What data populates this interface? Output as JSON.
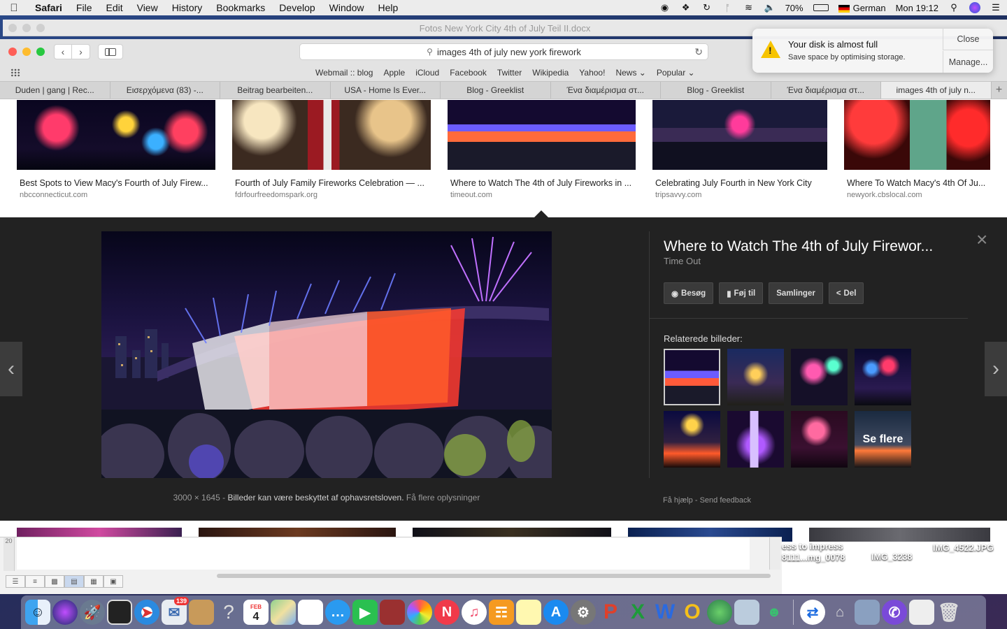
{
  "menubar": {
    "app": "Safari",
    "items": [
      "File",
      "Edit",
      "View",
      "History",
      "Bookmarks",
      "Develop",
      "Window",
      "Help"
    ],
    "battery": "70%",
    "input_source": "German",
    "clock": "Mon 19:12"
  },
  "doc_window": {
    "title": "Fotos New York City 4th of July Teil II.docx"
  },
  "toolbar": {
    "url": "images 4th of july new york firework",
    "favorites": [
      "Webmail :: blog",
      "Apple",
      "iCloud",
      "Facebook",
      "Twitter",
      "Wikipedia",
      "Yahoo!",
      "News ⌄",
      "Popular ⌄"
    ]
  },
  "tabs": [
    {
      "label": "Duden | gang | Rec..."
    },
    {
      "label": "Εισερχόμενα (83) -..."
    },
    {
      "label": "Beitrag bearbeiten..."
    },
    {
      "label": "USA - Home Is Ever..."
    },
    {
      "label": "Blog - Greeklist"
    },
    {
      "label": "Ένα διαμέρισμα στ..."
    },
    {
      "label": "Blog - Greeklist"
    },
    {
      "label": "Ένα διαμέρισμα στ..."
    },
    {
      "label": "images 4th of july n..."
    }
  ],
  "results": [
    {
      "caption": "Best Spots to View Macy's Fourth of July Firew...",
      "source": "nbcconnecticut.com"
    },
    {
      "caption": "Fourth of July Family Fireworks Celebration — ...",
      "source": "fdrfourfreedomspark.org"
    },
    {
      "caption": "Where to Watch The 4th of July Fireworks in ...",
      "source": "timeout.com"
    },
    {
      "caption": "Celebrating July Fourth in New York City",
      "source": "tripsavvy.com"
    },
    {
      "caption": "Where To Watch Macy's 4th Of Ju...",
      "source": "newyork.cbslocal.com"
    }
  ],
  "preview": {
    "title": "Where to Watch The 4th of July Firewor...",
    "source": "Time Out",
    "actions": [
      "Besøg",
      "Føj til",
      "Samlinger",
      "Del"
    ],
    "related_heading": "Relaterede billeder:",
    "see_more": "Se flere",
    "dimensions": "3000 × 1645",
    "copyright": "Billeder kan være beskyttet af ophavsretsloven.",
    "more_info": "Få flere oplysninger",
    "help": "Få hjælp",
    "feedback": "Send feedback"
  },
  "notification": {
    "title": "Your disk is almost full",
    "body": "Save space by optimising storage.",
    "close": "Close",
    "manage": "Manage..."
  },
  "desktop_files": [
    "ess to impress",
    "8111...mg_0078",
    "IMG_3238",
    "IMG_4522.JPG"
  ],
  "word": {
    "ruler_mark": "20"
  },
  "dock": {
    "calendar_month": "FEB",
    "calendar_day": "4",
    "mail_badge": "139",
    "apps": [
      "finder-icon",
      "siri-icon",
      "launchpad-icon",
      "photo-booth-icon",
      "safari-icon",
      "mail-icon",
      "notes-icon",
      "help-icon",
      "calendar-icon",
      "maps-icon",
      "reminders-icon",
      "messages-icon",
      "facetime-icon",
      "photo-icon",
      "photos-icon",
      "news-icon",
      "music-icon",
      "books-icon",
      "notes-yellow-icon",
      "app-store-icon",
      "system-preferences-icon",
      "powerpoint-icon",
      "excel-icon",
      "word-icon",
      "opera-icon",
      "vpn-icon",
      "preview-icon",
      "people-icon",
      "teamviewer-icon",
      "scanner-icon",
      "photos-app-icon",
      "viber-icon",
      "folder-icon",
      "trash-icon"
    ]
  }
}
